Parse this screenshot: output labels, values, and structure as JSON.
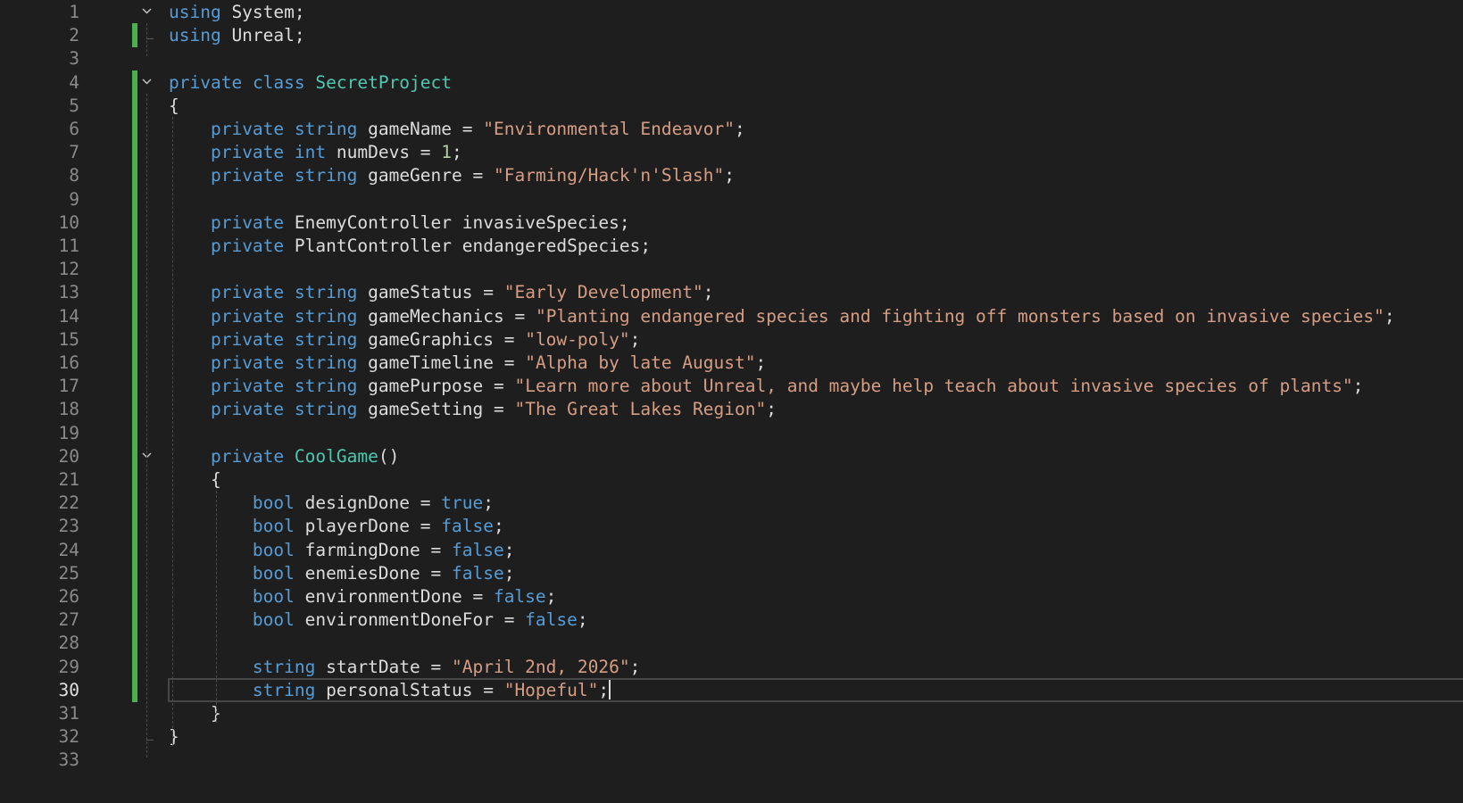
{
  "editor": {
    "lines": [
      {
        "n": "1",
        "tokens": [
          {
            "t": "kw",
            "v": "using"
          },
          {
            "t": "plain",
            "v": " System;"
          }
        ]
      },
      {
        "n": "2",
        "tokens": [
          {
            "t": "kw",
            "v": "using"
          },
          {
            "t": "plain",
            "v": " Unreal;"
          }
        ]
      },
      {
        "n": "3",
        "tokens": []
      },
      {
        "n": "4",
        "tokens": [
          {
            "t": "kw",
            "v": "private"
          },
          {
            "t": "plain",
            "v": " "
          },
          {
            "t": "kw",
            "v": "class"
          },
          {
            "t": "plain",
            "v": " "
          },
          {
            "t": "type",
            "v": "SecretProject"
          }
        ]
      },
      {
        "n": "5",
        "tokens": [
          {
            "t": "plain",
            "v": "{"
          }
        ]
      },
      {
        "n": "6",
        "tokens": [
          {
            "t": "plain",
            "v": "    "
          },
          {
            "t": "kw",
            "v": "private"
          },
          {
            "t": "plain",
            "v": " "
          },
          {
            "t": "kw",
            "v": "string"
          },
          {
            "t": "plain",
            "v": " gameName = "
          },
          {
            "t": "str",
            "v": "\"Environmental Endeavor\""
          },
          {
            "t": "plain",
            "v": ";"
          }
        ]
      },
      {
        "n": "7",
        "tokens": [
          {
            "t": "plain",
            "v": "    "
          },
          {
            "t": "kw",
            "v": "private"
          },
          {
            "t": "plain",
            "v": " "
          },
          {
            "t": "kw",
            "v": "int"
          },
          {
            "t": "plain",
            "v": " numDevs = "
          },
          {
            "t": "num",
            "v": "1"
          },
          {
            "t": "plain",
            "v": ";"
          }
        ]
      },
      {
        "n": "8",
        "tokens": [
          {
            "t": "plain",
            "v": "    "
          },
          {
            "t": "kw",
            "v": "private"
          },
          {
            "t": "plain",
            "v": " "
          },
          {
            "t": "kw",
            "v": "string"
          },
          {
            "t": "plain",
            "v": " gameGenre = "
          },
          {
            "t": "str",
            "v": "\"Farming/Hack'n'Slash\""
          },
          {
            "t": "plain",
            "v": ";"
          }
        ]
      },
      {
        "n": "9",
        "tokens": []
      },
      {
        "n": "10",
        "tokens": [
          {
            "t": "plain",
            "v": "    "
          },
          {
            "t": "kw",
            "v": "private"
          },
          {
            "t": "plain",
            "v": " EnemyController invasiveSpecies;"
          }
        ]
      },
      {
        "n": "11",
        "tokens": [
          {
            "t": "plain",
            "v": "    "
          },
          {
            "t": "kw",
            "v": "private"
          },
          {
            "t": "plain",
            "v": " PlantController endangeredSpecies;"
          }
        ]
      },
      {
        "n": "12",
        "tokens": []
      },
      {
        "n": "13",
        "tokens": [
          {
            "t": "plain",
            "v": "    "
          },
          {
            "t": "kw",
            "v": "private"
          },
          {
            "t": "plain",
            "v": " "
          },
          {
            "t": "kw",
            "v": "string"
          },
          {
            "t": "plain",
            "v": " gameStatus = "
          },
          {
            "t": "str",
            "v": "\"Early Development\""
          },
          {
            "t": "plain",
            "v": ";"
          }
        ]
      },
      {
        "n": "14",
        "tokens": [
          {
            "t": "plain",
            "v": "    "
          },
          {
            "t": "kw",
            "v": "private"
          },
          {
            "t": "plain",
            "v": " "
          },
          {
            "t": "kw",
            "v": "string"
          },
          {
            "t": "plain",
            "v": " gameMechanics = "
          },
          {
            "t": "str",
            "v": "\"Planting endangered species and fighting off monsters based on invasive species\""
          },
          {
            "t": "plain",
            "v": ";"
          }
        ]
      },
      {
        "n": "15",
        "tokens": [
          {
            "t": "plain",
            "v": "    "
          },
          {
            "t": "kw",
            "v": "private"
          },
          {
            "t": "plain",
            "v": " "
          },
          {
            "t": "kw",
            "v": "string"
          },
          {
            "t": "plain",
            "v": " gameGraphics = "
          },
          {
            "t": "str",
            "v": "\"low-poly\""
          },
          {
            "t": "plain",
            "v": ";"
          }
        ]
      },
      {
        "n": "16",
        "tokens": [
          {
            "t": "plain",
            "v": "    "
          },
          {
            "t": "kw",
            "v": "private"
          },
          {
            "t": "plain",
            "v": " "
          },
          {
            "t": "kw",
            "v": "string"
          },
          {
            "t": "plain",
            "v": " gameTimeline = "
          },
          {
            "t": "str",
            "v": "\"Alpha by late August\""
          },
          {
            "t": "plain",
            "v": ";"
          }
        ]
      },
      {
        "n": "17",
        "tokens": [
          {
            "t": "plain",
            "v": "    "
          },
          {
            "t": "kw",
            "v": "private"
          },
          {
            "t": "plain",
            "v": " "
          },
          {
            "t": "kw",
            "v": "string"
          },
          {
            "t": "plain",
            "v": " gamePurpose = "
          },
          {
            "t": "str",
            "v": "\"Learn more about Unreal, and maybe help teach about invasive species of plants\""
          },
          {
            "t": "plain",
            "v": ";"
          }
        ]
      },
      {
        "n": "18",
        "tokens": [
          {
            "t": "plain",
            "v": "    "
          },
          {
            "t": "kw",
            "v": "private"
          },
          {
            "t": "plain",
            "v": " "
          },
          {
            "t": "kw",
            "v": "string"
          },
          {
            "t": "plain",
            "v": " gameSetting = "
          },
          {
            "t": "str",
            "v": "\"The Great Lakes Region\""
          },
          {
            "t": "plain",
            "v": ";"
          }
        ]
      },
      {
        "n": "19",
        "tokens": []
      },
      {
        "n": "20",
        "tokens": [
          {
            "t": "plain",
            "v": "    "
          },
          {
            "t": "kw",
            "v": "private"
          },
          {
            "t": "plain",
            "v": " "
          },
          {
            "t": "type",
            "v": "CoolGame"
          },
          {
            "t": "plain",
            "v": "()"
          }
        ]
      },
      {
        "n": "21",
        "tokens": [
          {
            "t": "plain",
            "v": "    {"
          }
        ]
      },
      {
        "n": "22",
        "tokens": [
          {
            "t": "plain",
            "v": "        "
          },
          {
            "t": "kw",
            "v": "bool"
          },
          {
            "t": "plain",
            "v": " designDone = "
          },
          {
            "t": "kw",
            "v": "true"
          },
          {
            "t": "plain",
            "v": ";"
          }
        ]
      },
      {
        "n": "23",
        "tokens": [
          {
            "t": "plain",
            "v": "        "
          },
          {
            "t": "kw",
            "v": "bool"
          },
          {
            "t": "plain",
            "v": " playerDone = "
          },
          {
            "t": "kw",
            "v": "false"
          },
          {
            "t": "plain",
            "v": ";"
          }
        ]
      },
      {
        "n": "24",
        "tokens": [
          {
            "t": "plain",
            "v": "        "
          },
          {
            "t": "kw",
            "v": "bool"
          },
          {
            "t": "plain",
            "v": " farmingDone = "
          },
          {
            "t": "kw",
            "v": "false"
          },
          {
            "t": "plain",
            "v": ";"
          }
        ]
      },
      {
        "n": "25",
        "tokens": [
          {
            "t": "plain",
            "v": "        "
          },
          {
            "t": "kw",
            "v": "bool"
          },
          {
            "t": "plain",
            "v": " enemiesDone = "
          },
          {
            "t": "kw",
            "v": "false"
          },
          {
            "t": "plain",
            "v": ";"
          }
        ]
      },
      {
        "n": "26",
        "tokens": [
          {
            "t": "plain",
            "v": "        "
          },
          {
            "t": "kw",
            "v": "bool"
          },
          {
            "t": "plain",
            "v": " environmentDone = "
          },
          {
            "t": "kw",
            "v": "false"
          },
          {
            "t": "plain",
            "v": ";"
          }
        ]
      },
      {
        "n": "27",
        "tokens": [
          {
            "t": "plain",
            "v": "        "
          },
          {
            "t": "kw",
            "v": "bool"
          },
          {
            "t": "plain",
            "v": " environmentDoneFor = "
          },
          {
            "t": "kw",
            "v": "false"
          },
          {
            "t": "plain",
            "v": ";"
          }
        ]
      },
      {
        "n": "28",
        "tokens": []
      },
      {
        "n": "29",
        "tokens": [
          {
            "t": "plain",
            "v": "        "
          },
          {
            "t": "kw",
            "v": "string"
          },
          {
            "t": "plain",
            "v": " startDate = "
          },
          {
            "t": "str",
            "v": "\"April 2nd, 2026\""
          },
          {
            "t": "plain",
            "v": ";"
          }
        ]
      },
      {
        "n": "30",
        "tokens": [
          {
            "t": "plain",
            "v": "        "
          },
          {
            "t": "kw",
            "v": "string"
          },
          {
            "t": "plain",
            "v": " personalStatus = "
          },
          {
            "t": "str",
            "v": "\"Hopeful\""
          },
          {
            "t": "plain",
            "v": ";"
          }
        ]
      },
      {
        "n": "31",
        "tokens": [
          {
            "t": "plain",
            "v": "    }"
          }
        ]
      },
      {
        "n": "32",
        "tokens": [
          {
            "t": "plain",
            "v": "}"
          }
        ]
      },
      {
        "n": "33",
        "tokens": []
      }
    ],
    "active_line": "30",
    "changed_lines": [
      "2",
      "4",
      "5",
      "6",
      "7",
      "8",
      "9",
      "10",
      "11",
      "12",
      "13",
      "14",
      "15",
      "16",
      "17",
      "18",
      "19",
      "20",
      "21",
      "22",
      "23",
      "24",
      "25",
      "26",
      "27",
      "28",
      "29",
      "30"
    ],
    "fold_lines": [
      "1",
      "4",
      "20"
    ],
    "colors": {
      "background": "#1e1e1e",
      "keyword": "#569cd6",
      "type": "#4ec9b0",
      "string": "#d69d85",
      "number": "#b5cea8",
      "identifier": "#dcdcdc",
      "line_number": "#8a8a8a",
      "change_bar": "#4caf50"
    }
  }
}
